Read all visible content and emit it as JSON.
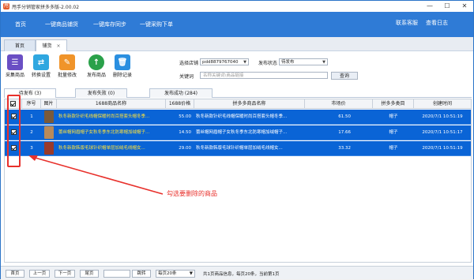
{
  "window": {
    "title": "甩手分销管家拼多多版-2.00.02",
    "icon": "app-logo-icon",
    "controls": [
      "—",
      "☐",
      "✕"
    ]
  },
  "menubar": {
    "items": [
      "首页",
      "一键商品铺货",
      "一键库存同步",
      "一键采购下单"
    ],
    "right": [
      "联系客服",
      "查看日志"
    ]
  },
  "tabs": [
    {
      "label": "首页"
    },
    {
      "label": "铺货",
      "close": "×"
    }
  ],
  "toolbar": [
    {
      "label": "采集商品",
      "icon": "list-collect-icon",
      "color": "#6a4fc4"
    },
    {
      "label": "转换设置",
      "icon": "settings-convert-icon",
      "color": "#2fa7e0"
    },
    {
      "label": "批量修改",
      "icon": "edit-pencil-icon",
      "color": "#f0942a"
    },
    {
      "label": "发布商品",
      "icon": "upload-publish-icon",
      "color": "#2aa14a"
    },
    {
      "label": "删除记录",
      "icon": "trash-delete-icon",
      "color": "#2a8fe0"
    }
  ],
  "filters": {
    "store_label": "选择店铺",
    "store_value": "pdd8879767040",
    "status_label": "发布状态",
    "status_value": "待发布",
    "keyword_label": "关键词",
    "keyword_placeholder": "名称关键词\\商品链接",
    "query_button": "查询"
  },
  "subtabs": [
    "待发布 (3)",
    "发布失败 (0)",
    "发布成功 (284)"
  ],
  "columns": [
    "序号",
    "图片",
    "1688商品名称",
    "1688价格",
    "拼多多商品名称",
    "市场价",
    "拼多多类目",
    "创建时间"
  ],
  "rows": [
    {
      "no": "1",
      "name1688": "秋冬新款针织毛线帽保暖时尚百搭套头帽冬季...",
      "price": "55.00",
      "namePdd": "秋冬新款针织毛线帽保暖时尚百搭套头帽冬季...",
      "market": "61.50",
      "category": "帽子",
      "time": "2020/7/1 10:51:19",
      "thumb": "#7a5a3a"
    },
    {
      "no": "2",
      "name1688": "蕾丝帽网眉帽子女秋冬季东北防寒帽加绒帽子...",
      "price": "14.50",
      "namePdd": "蕾丝帽网眉帽子女秋冬季东北防寒帽加绒帽子...",
      "market": "17.66",
      "category": "帽子",
      "time": "2020/7/1 10:51:17",
      "thumb": "#b88a5a"
    },
    {
      "no": "3",
      "name1688": "秋冬新款韩版毛球针织帽单层加绒毛线帽女...",
      "price": "29.00",
      "namePdd": "秋冬新款韩版毛球针织帽单层加绒毛线帽女...",
      "market": "33.32",
      "category": "帽子",
      "time": "2020/7/1 10:51:19",
      "thumb": "#9a3a2a"
    }
  ],
  "annotation": "勾选要删除的商品",
  "pager": {
    "first": "首页",
    "prev": "上一页",
    "next": "下一页",
    "last": "尾页",
    "jump": "跳转",
    "page_size": "每页20条",
    "info": "共1页商品信息，每页20条，当前第1页"
  },
  "colors": {
    "accent": "#2f7bd6",
    "selected_row": "#0a64d6",
    "annotation": "#e8312c"
  }
}
